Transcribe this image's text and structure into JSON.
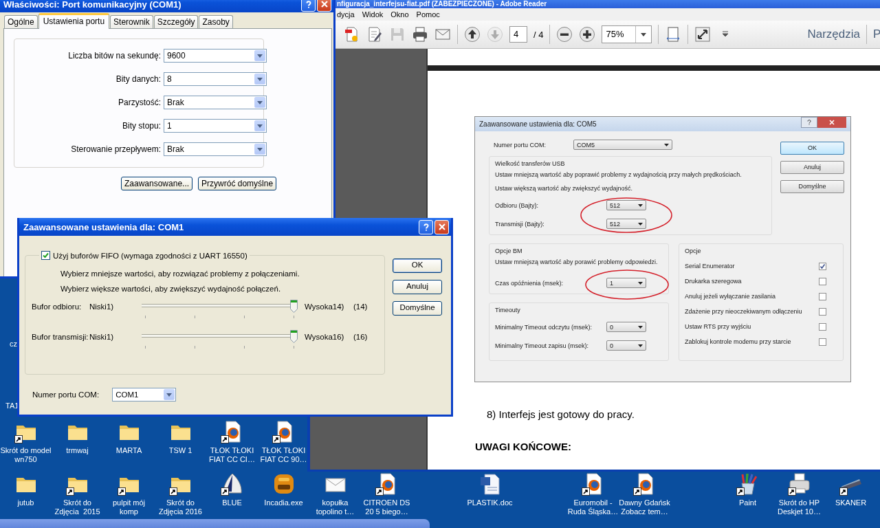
{
  "properties_dialog": {
    "title": "Właściwości: Port komunikacyjny (COM1)",
    "tabs": [
      {
        "label": "Ogólne",
        "selected": false
      },
      {
        "label": "Ustawienia portu",
        "selected": true
      },
      {
        "label": "Sterownik",
        "selected": false
      },
      {
        "label": "Szczegóły",
        "selected": false
      },
      {
        "label": "Zasoby",
        "selected": false
      }
    ],
    "fields": [
      {
        "label": "Liczba bitów na sekundę:",
        "value": "9600"
      },
      {
        "label": "Bity danych:",
        "value": "8"
      },
      {
        "label": "Parzystość:",
        "value": "Brak"
      },
      {
        "label": "Bity stopu:",
        "value": "1"
      },
      {
        "label": "Sterowanie przepływem:",
        "value": "Brak"
      }
    ],
    "buttons": [
      "Zaawansowane...",
      "Przywróć domyślne"
    ]
  },
  "advanced_dialog": {
    "title": "Zaawansowane ustawienia dla: COM1",
    "fifo": {
      "label": "Użyj buforów FIFO (wymaga zgodności z UART 16550)",
      "checked": true
    },
    "hints": [
      "Wybierz mniejsze wartości, aby rozwiązać problemy z połączeniami.",
      "Wybierz większe wartości, aby zwiększyć wydajność połączeń."
    ],
    "sliders": [
      {
        "label": "Bufor odbioru:",
        "low": "Niski1)",
        "high": "Wysoka14)",
        "reading": "(14)",
        "level": 1
      },
      {
        "label": "Bufor transmisji:",
        "low": "Niski1)",
        "high": "Wysoka16)",
        "reading": "(16)",
        "level": 1
      }
    ],
    "port": {
      "label": "Numer portu COM:",
      "value": "COM1"
    },
    "buttons": [
      "OK",
      "Anuluj",
      "Domyślne"
    ]
  },
  "reader": {
    "title": "nfiguracja_interfejsu-fiat.pdf (ZABEZPIECZONE) - Adobe Reader",
    "menu": [
      "dycja",
      "Widok",
      "Okno",
      "Pomoc"
    ],
    "file_tools": [
      {
        "kind": "create",
        "disabled": false
      },
      {
        "kind": "edit",
        "disabled": false
      },
      {
        "kind": "save",
        "disabled": true
      },
      {
        "kind": "print",
        "disabled": false
      },
      {
        "kind": "email",
        "disabled": false
      }
    ],
    "page_tools": [
      {
        "kind": "previous",
        "disabled": false
      },
      {
        "kind": "next",
        "disabled": true
      }
    ],
    "page": "4",
    "page_total": "/ 4",
    "zoom_tools": [
      {
        "kind": "zoom-out",
        "disabled": false
      },
      {
        "kind": "zoom-in",
        "disabled": false
      }
    ],
    "zoom": "75%",
    "view_tools": [
      {
        "kind": "fit-page",
        "disabled": false
      },
      {
        "kind": "full-screen",
        "disabled": false
      },
      {
        "kind": "more",
        "disabled": false
      }
    ],
    "tools_label": "Narzędzia",
    "cut_label": "P",
    "document": {
      "figure": {
        "title": "Zaawansowane ustawienia dla: COM5",
        "port": {
          "label": "Numer portu COM:",
          "value": "COM5"
        },
        "usb": {
          "title": "Wielkość transferów USB",
          "hints": [
            "Ustaw mniejszą wartość aby poprawić problemy z wydajnością przy małych prędkościach.",
            "Ustaw większą wartość aby zwiększyć wydajność."
          ],
          "fields": [
            {
              "label": "Odbioru (Bajty):",
              "value": "512"
            },
            {
              "label": "Transmisji (Bajty):",
              "value": "512"
            }
          ]
        },
        "bm": {
          "title": "Opcje BM",
          "hint": "Ustaw mniejszą wartość aby porawić problemy odpowiedzi.",
          "fields": [
            {
              "label": "Czas opóźnienia (msek):",
              "value": "1"
            }
          ]
        },
        "timeouts": {
          "title": "Timeouty",
          "fields": [
            {
              "label": "Minimalny Timeout odczytu (msek):",
              "value": "0"
            },
            {
              "label": "Minimalny Timeout zapisu (msek):",
              "value": "0"
            }
          ]
        },
        "options": {
          "title": "Opcje",
          "items": [
            {
              "label": "Serial Enumerator",
              "checked": true
            },
            {
              "label": "Drukarka szeregowa",
              "checked": false
            },
            {
              "label": "Anuluj jeżeli wyłączanie zasilania",
              "checked": false
            },
            {
              "label": "Zdażenie przy nieoczekiwanym odłączeniu",
              "checked": false
            },
            {
              "label": "Ustaw RTS przy wyjściu",
              "checked": false
            },
            {
              "label": "Zablokuj kontrole modemu przy starcie",
              "checked": false
            }
          ]
        },
        "buttons": [
          "OK",
          "Anuluj",
          "Domyślne"
        ]
      },
      "step": "8) Interfejs jest gotowy do pracy.",
      "heading": "UWAGI KOŃCOWE:"
    }
  },
  "desktop": {
    "cut_labels": [
      "cz",
      "TA1"
    ],
    "row_1": [
      {
        "label": "Skrót do model wn750",
        "kind": "folder",
        "shortcut": true
      },
      {
        "label": "trmwaj",
        "kind": "folder",
        "shortcut": false
      },
      {
        "label": "MARTA",
        "kind": "folder",
        "shortcut": false
      },
      {
        "label": "TSW 1",
        "kind": "folder",
        "shortcut": false
      },
      {
        "label": "TŁOK TŁOKI FIAT CC CI…",
        "kind": "firefox",
        "shortcut": true
      },
      {
        "label": "TŁOK TŁOKI FIAT CC 90…",
        "kind": "firefox",
        "shortcut": true
      }
    ],
    "row_2": [
      {
        "label": "jutub",
        "kind": "folder",
        "shortcut": false
      },
      {
        "label": "Skrót do Zdjęcia  2015",
        "kind": "folder",
        "shortcut": true
      },
      {
        "label": "pulpit mój komp",
        "kind": "folder",
        "shortcut": true
      },
      {
        "label": "Skrót do Zdjęcia 2016",
        "kind": "folder",
        "shortcut": true
      },
      {
        "label": "BLUE",
        "kind": "sail",
        "shortcut": true
      },
      {
        "label": "Incadia.exe",
        "kind": "app",
        "shortcut": false
      },
      {
        "label": "kopułka topolino t…",
        "kind": "mail",
        "shortcut": false
      },
      {
        "label": "CITROEN DS 20 5 biego…",
        "kind": "firefox",
        "shortcut": true
      },
      {
        "label": "PLASTIK.doc",
        "kind": "word",
        "shortcut": false
      },
      {
        "label": "Euromobil - Ruda Śląska…",
        "kind": "firefox",
        "shortcut": true
      },
      {
        "label": "Dawny Gdańsk Zobacz tem…",
        "kind": "firefox",
        "shortcut": true
      },
      {
        "label": "Paint",
        "kind": "paint",
        "shortcut": true
      },
      {
        "label": "Skrót do HP Deskjet 10…",
        "kind": "printer",
        "shortcut": true
      },
      {
        "label": "SKANER",
        "kind": "scanner",
        "shortcut": true
      }
    ]
  }
}
